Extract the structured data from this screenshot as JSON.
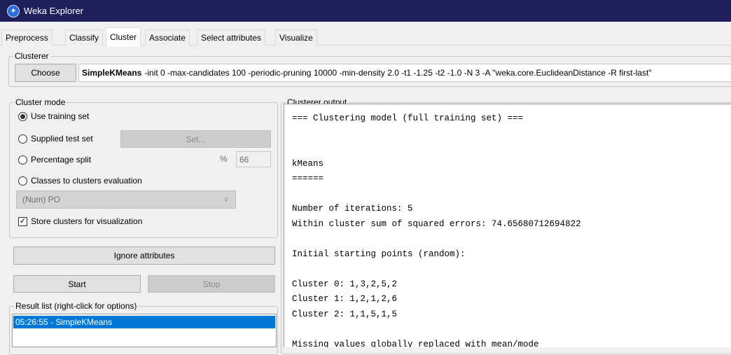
{
  "window": {
    "title": "Weka Explorer"
  },
  "tabs": [
    "Preprocess",
    "Classify",
    "Cluster",
    "Associate",
    "Select attributes",
    "Visualize"
  ],
  "active_tab": "Cluster",
  "clusterer": {
    "group_label": "Clusterer",
    "choose_label": "Choose",
    "name": "SimpleKMeans",
    "options": "-init 0 -max-candidates 100 -periodic-pruning 10000 -min-density 2.0 -t1 -1.25 -t2 -1.0 -N 3 -A \"weka.core.EuclideanDistance -R first-last\""
  },
  "cluster_mode": {
    "group_label": "Cluster mode",
    "use_training_set": "Use training set",
    "supplied_test_set": "Supplied test set",
    "set_button": "Set...",
    "percentage_split": "Percentage split",
    "percent_sign": "%",
    "percent_value": "66",
    "classes_to_clusters": "Classes to clusters evaluation",
    "class_attribute": "(Num) PO",
    "store_clusters": "Store clusters for visualization",
    "selected": "use_training_set",
    "store_checked": true
  },
  "buttons": {
    "ignore_attributes": "Ignore attributes",
    "start": "Start",
    "stop": "Stop"
  },
  "result_list": {
    "label": "Result list (right-click for options)",
    "items": [
      "05:26:55 - SimpleKMeans"
    ]
  },
  "output": {
    "label": "Clusterer output",
    "lines": [
      "=== Clustering model (full training set) ===",
      "",
      "",
      "kMeans",
      "======",
      "",
      "Number of iterations: 5",
      "Within cluster sum of squared errors: 74.65680712694822",
      "",
      "Initial starting points (random):",
      "",
      "Cluster 0: 1,3,2,5,2",
      "Cluster 1: 1,2,1,2,6",
      "Cluster 2: 1,1,5,1,5",
      "",
      "Missing values globally replaced with mean/mode"
    ]
  }
}
